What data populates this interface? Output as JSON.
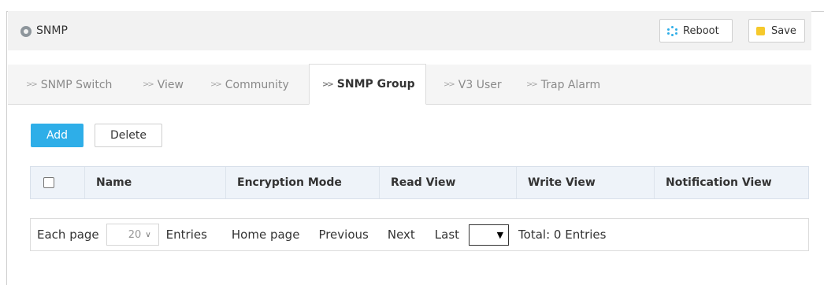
{
  "header": {
    "title": "SNMP",
    "reboot_label": "Reboot",
    "save_label": "Save"
  },
  "tabs": [
    {
      "label": "SNMP Switch",
      "active": false
    },
    {
      "label": "View",
      "active": false
    },
    {
      "label": "Community",
      "active": false
    },
    {
      "label": "SNMP Group",
      "active": true
    },
    {
      "label": "V3 User",
      "active": false
    },
    {
      "label": "Trap Alarm",
      "active": false
    }
  ],
  "actions": {
    "add_label": "Add",
    "delete_label": "Delete"
  },
  "table": {
    "columns": [
      "Name",
      "Encryption Mode",
      "Read View",
      "Write View",
      "Notification View"
    ],
    "rows": []
  },
  "pager": {
    "each_page_label": "Each page",
    "page_size": "20",
    "entries_label": "Entries",
    "home_label": "Home page",
    "previous_label": "Previous",
    "next_label": "Next",
    "last_label": "Last",
    "page_jump_value": "",
    "total_label": "Total: 0 Entries"
  },
  "colors": {
    "accent": "#2eaee8",
    "header_bg": "#f2f2f2",
    "table_header_bg": "#eef3f9",
    "save_icon": "#f6c92b"
  },
  "icons": {
    "header": "snmp-circle-icon",
    "reboot": "reboot-spinner-icon",
    "save": "save-icon",
    "tab_arrow": "tab-arrow-icon",
    "dropdown": "chevron-down-icon"
  }
}
